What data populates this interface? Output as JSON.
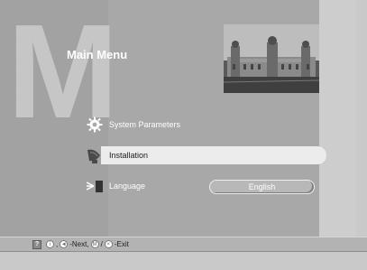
{
  "title": "Main Menu",
  "background_letter": "M",
  "menu": {
    "items": [
      {
        "label": "System Parameters",
        "icon": "gear-icon"
      },
      {
        "label": "Installation",
        "icon": "satellite-dish-icon",
        "selected": true
      },
      {
        "label": "Language",
        "icon": "language-icon",
        "value": "English"
      }
    ]
  },
  "footer": {
    "next_label": "-Next,",
    "separator_comma": ",",
    "separator_slash": "/",
    "exit_label": "-Exit",
    "help_glyph": "?",
    "info_glyph": "i",
    "nav_glyph": "◄",
    "menu_glyph": "M",
    "exit_glyph": "×"
  },
  "colors": {
    "left_panel": "#a2a2a2",
    "center_panel": "#a8a8a8",
    "highlight": "#ececec",
    "background": "#c9c9c9"
  }
}
